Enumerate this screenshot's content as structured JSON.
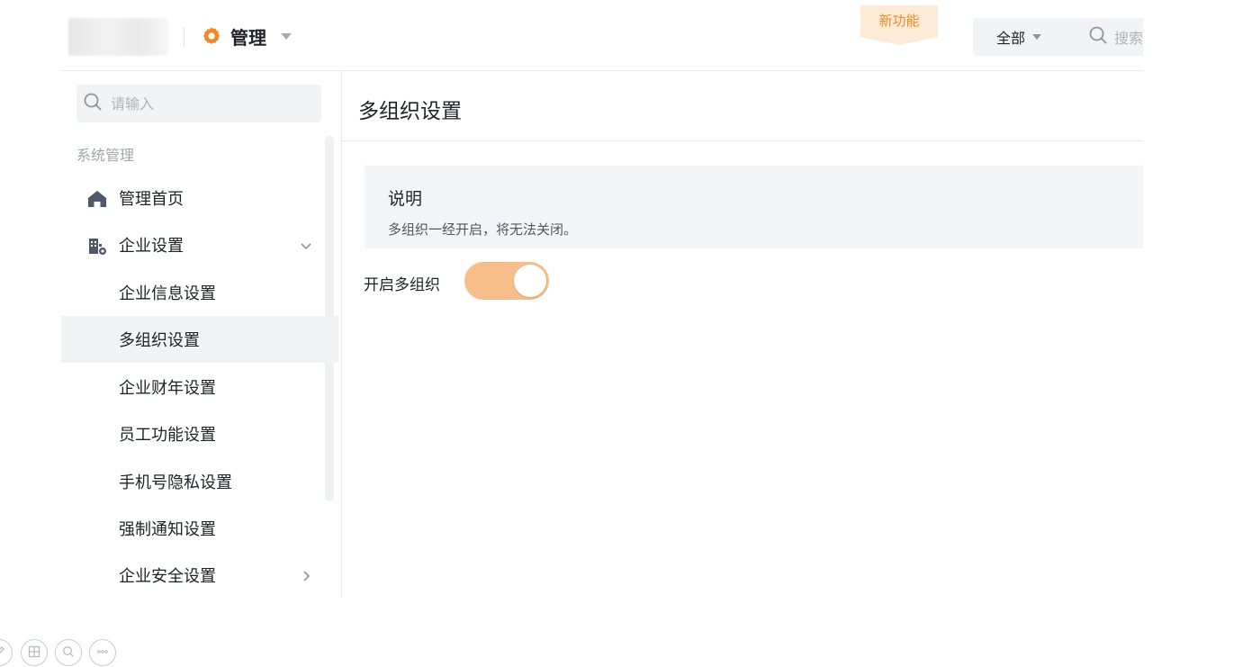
{
  "header": {
    "admin_label": "管理",
    "new_feature_badge": "新功能",
    "scope_label": "全部",
    "search_placeholder": "搜索"
  },
  "sidebar": {
    "search_placeholder": "请输入",
    "section_title": "系统管理",
    "items": [
      {
        "label": "管理首页",
        "icon": "home-icon"
      },
      {
        "label": "企业设置",
        "icon": "building-settings-icon",
        "expanded": true
      },
      {
        "label": "企业信息设置"
      },
      {
        "label": "多组织设置",
        "active": true
      },
      {
        "label": "企业财年设置"
      },
      {
        "label": "员工功能设置"
      },
      {
        "label": "手机号隐私设置"
      },
      {
        "label": "强制通知设置"
      },
      {
        "label": "企业安全设置",
        "has_children": true
      }
    ]
  },
  "main": {
    "page_title": "多组织设置",
    "notice_title": "说明",
    "notice_text": "多组织一经开启，将无法关闭。",
    "toggle_label": "开启多组织",
    "toggle_on": true
  },
  "colors": {
    "accent": "#f08a24",
    "toggle_on": "#f7be8a",
    "active_bg": "#f2f3f5",
    "notice_bg": "#f4f5f8"
  },
  "bottom_tools": [
    "edit-icon",
    "layout-icon",
    "zoom-icon",
    "more-icon"
  ]
}
